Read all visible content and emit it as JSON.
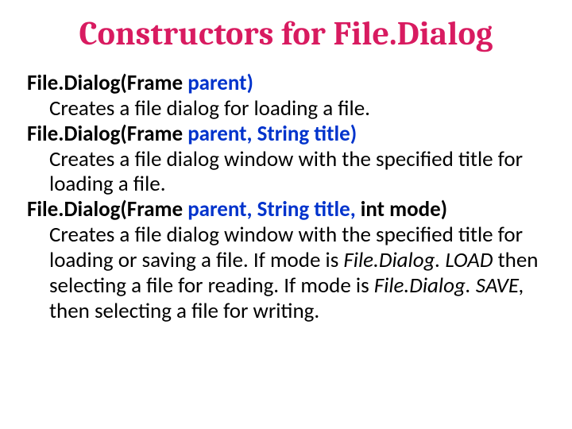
{
  "title": "Constructors for File.Dialog",
  "items": [
    {
      "sig_before_link": "File.Dialog(Frame",
      "sig_link": " parent)",
      "sig_after_link": "",
      "desc_parts": [
        {
          "text": "Creates a file dialog for loading a file.",
          "italic": false
        }
      ]
    },
    {
      "sig_before_link": "File.Dialog(Frame",
      "sig_link": " parent, String title)",
      "sig_after_link": "",
      "desc_parts": [
        {
          "text": "Creates a file dialog window with the specified title for loading a file.",
          "italic": false
        }
      ]
    },
    {
      "sig_before_link": "File.Dialog(Frame",
      "sig_link": " parent, String title, ",
      "sig_after_link": "int mode)",
      "desc_parts": [
        {
          "text": "Creates a file dialog window with the specified title for loading or saving a file. If mode is ",
          "italic": false
        },
        {
          "text": "File.Dialog. LOAD",
          "italic": true
        },
        {
          "text": " then selecting a file for reading. If mode is ",
          "italic": false
        },
        {
          "text": "File.Dialog. SAVE,",
          "italic": true
        },
        {
          "text": " then selecting a file for writing.",
          "italic": false
        }
      ]
    }
  ]
}
